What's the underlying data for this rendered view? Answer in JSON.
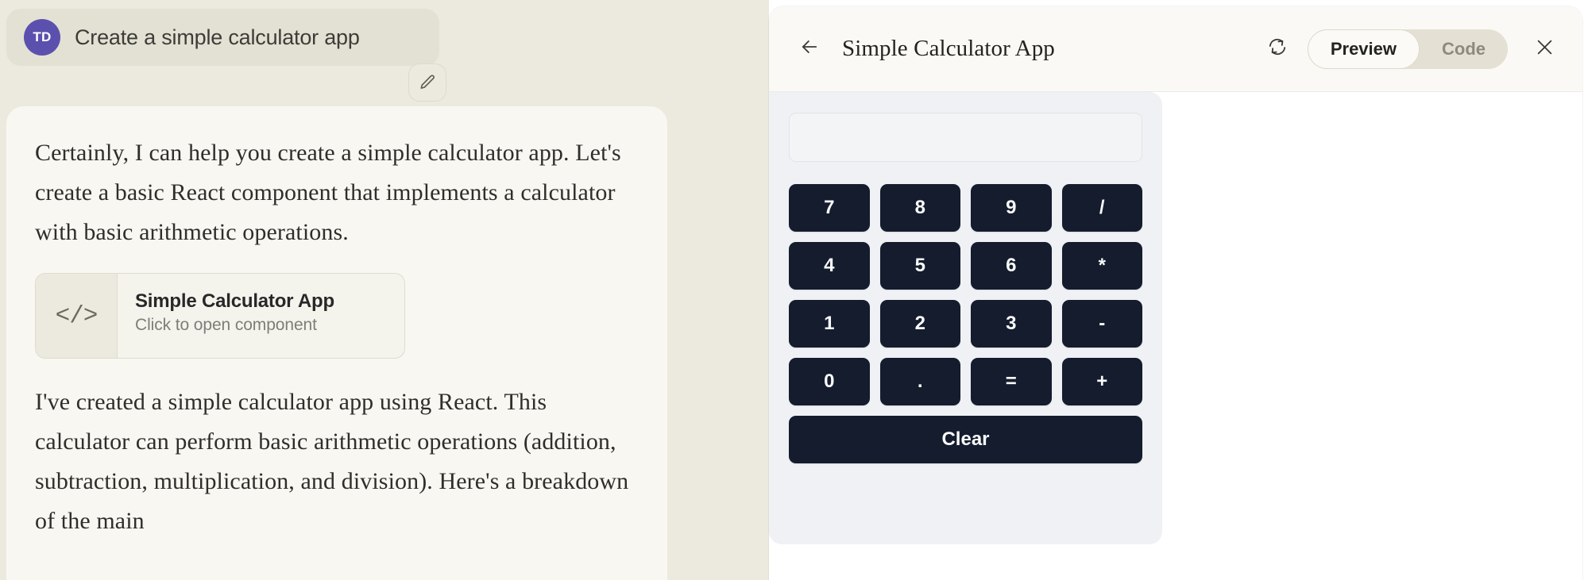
{
  "theme": {
    "page_bg": "#eceadf",
    "assistant_bubble_bg": "#f8f7f2",
    "avatar_color": "#5c50ae",
    "panel_bg": "#ffffff",
    "calculator_bg": "#eff1f4",
    "key_bg": "#141c2e",
    "key_text": "#fafafa"
  },
  "chat": {
    "user": {
      "avatar_initials": "TD",
      "message": "Create a simple calculator app",
      "edit_icon": "pencil-icon"
    },
    "assistant": {
      "paragraph_1": "Certainly, I can help you create a simple calculator app. Let's create a basic React component that implements a calculator with basic arithmetic operations.",
      "paragraph_2": "I've created a simple calculator app using React. This calculator can perform basic arithmetic operations (addition, subtraction, multiplication, and division). Here's a breakdown of the main",
      "artifact_card": {
        "icon": "code-icon",
        "icon_glyph": "</>",
        "title": "Simple Calculator App",
        "subtitle": "Click to open component"
      }
    }
  },
  "artifact_panel": {
    "back_icon": "arrow-left-icon",
    "title": "Simple Calculator App",
    "refresh_icon": "refresh-icon",
    "close_icon": "close-icon",
    "view_toggle": {
      "options": [
        "Preview",
        "Code"
      ],
      "selected": "Preview",
      "preview_label": "Preview",
      "code_label": "Code"
    }
  },
  "calculator": {
    "display_value": "",
    "display_placeholder": "",
    "keys": [
      "7",
      "8",
      "9",
      "/",
      "4",
      "5",
      "6",
      "*",
      "1",
      "2",
      "3",
      "-",
      "0",
      ".",
      "=",
      "+"
    ],
    "clear_label": "Clear"
  }
}
